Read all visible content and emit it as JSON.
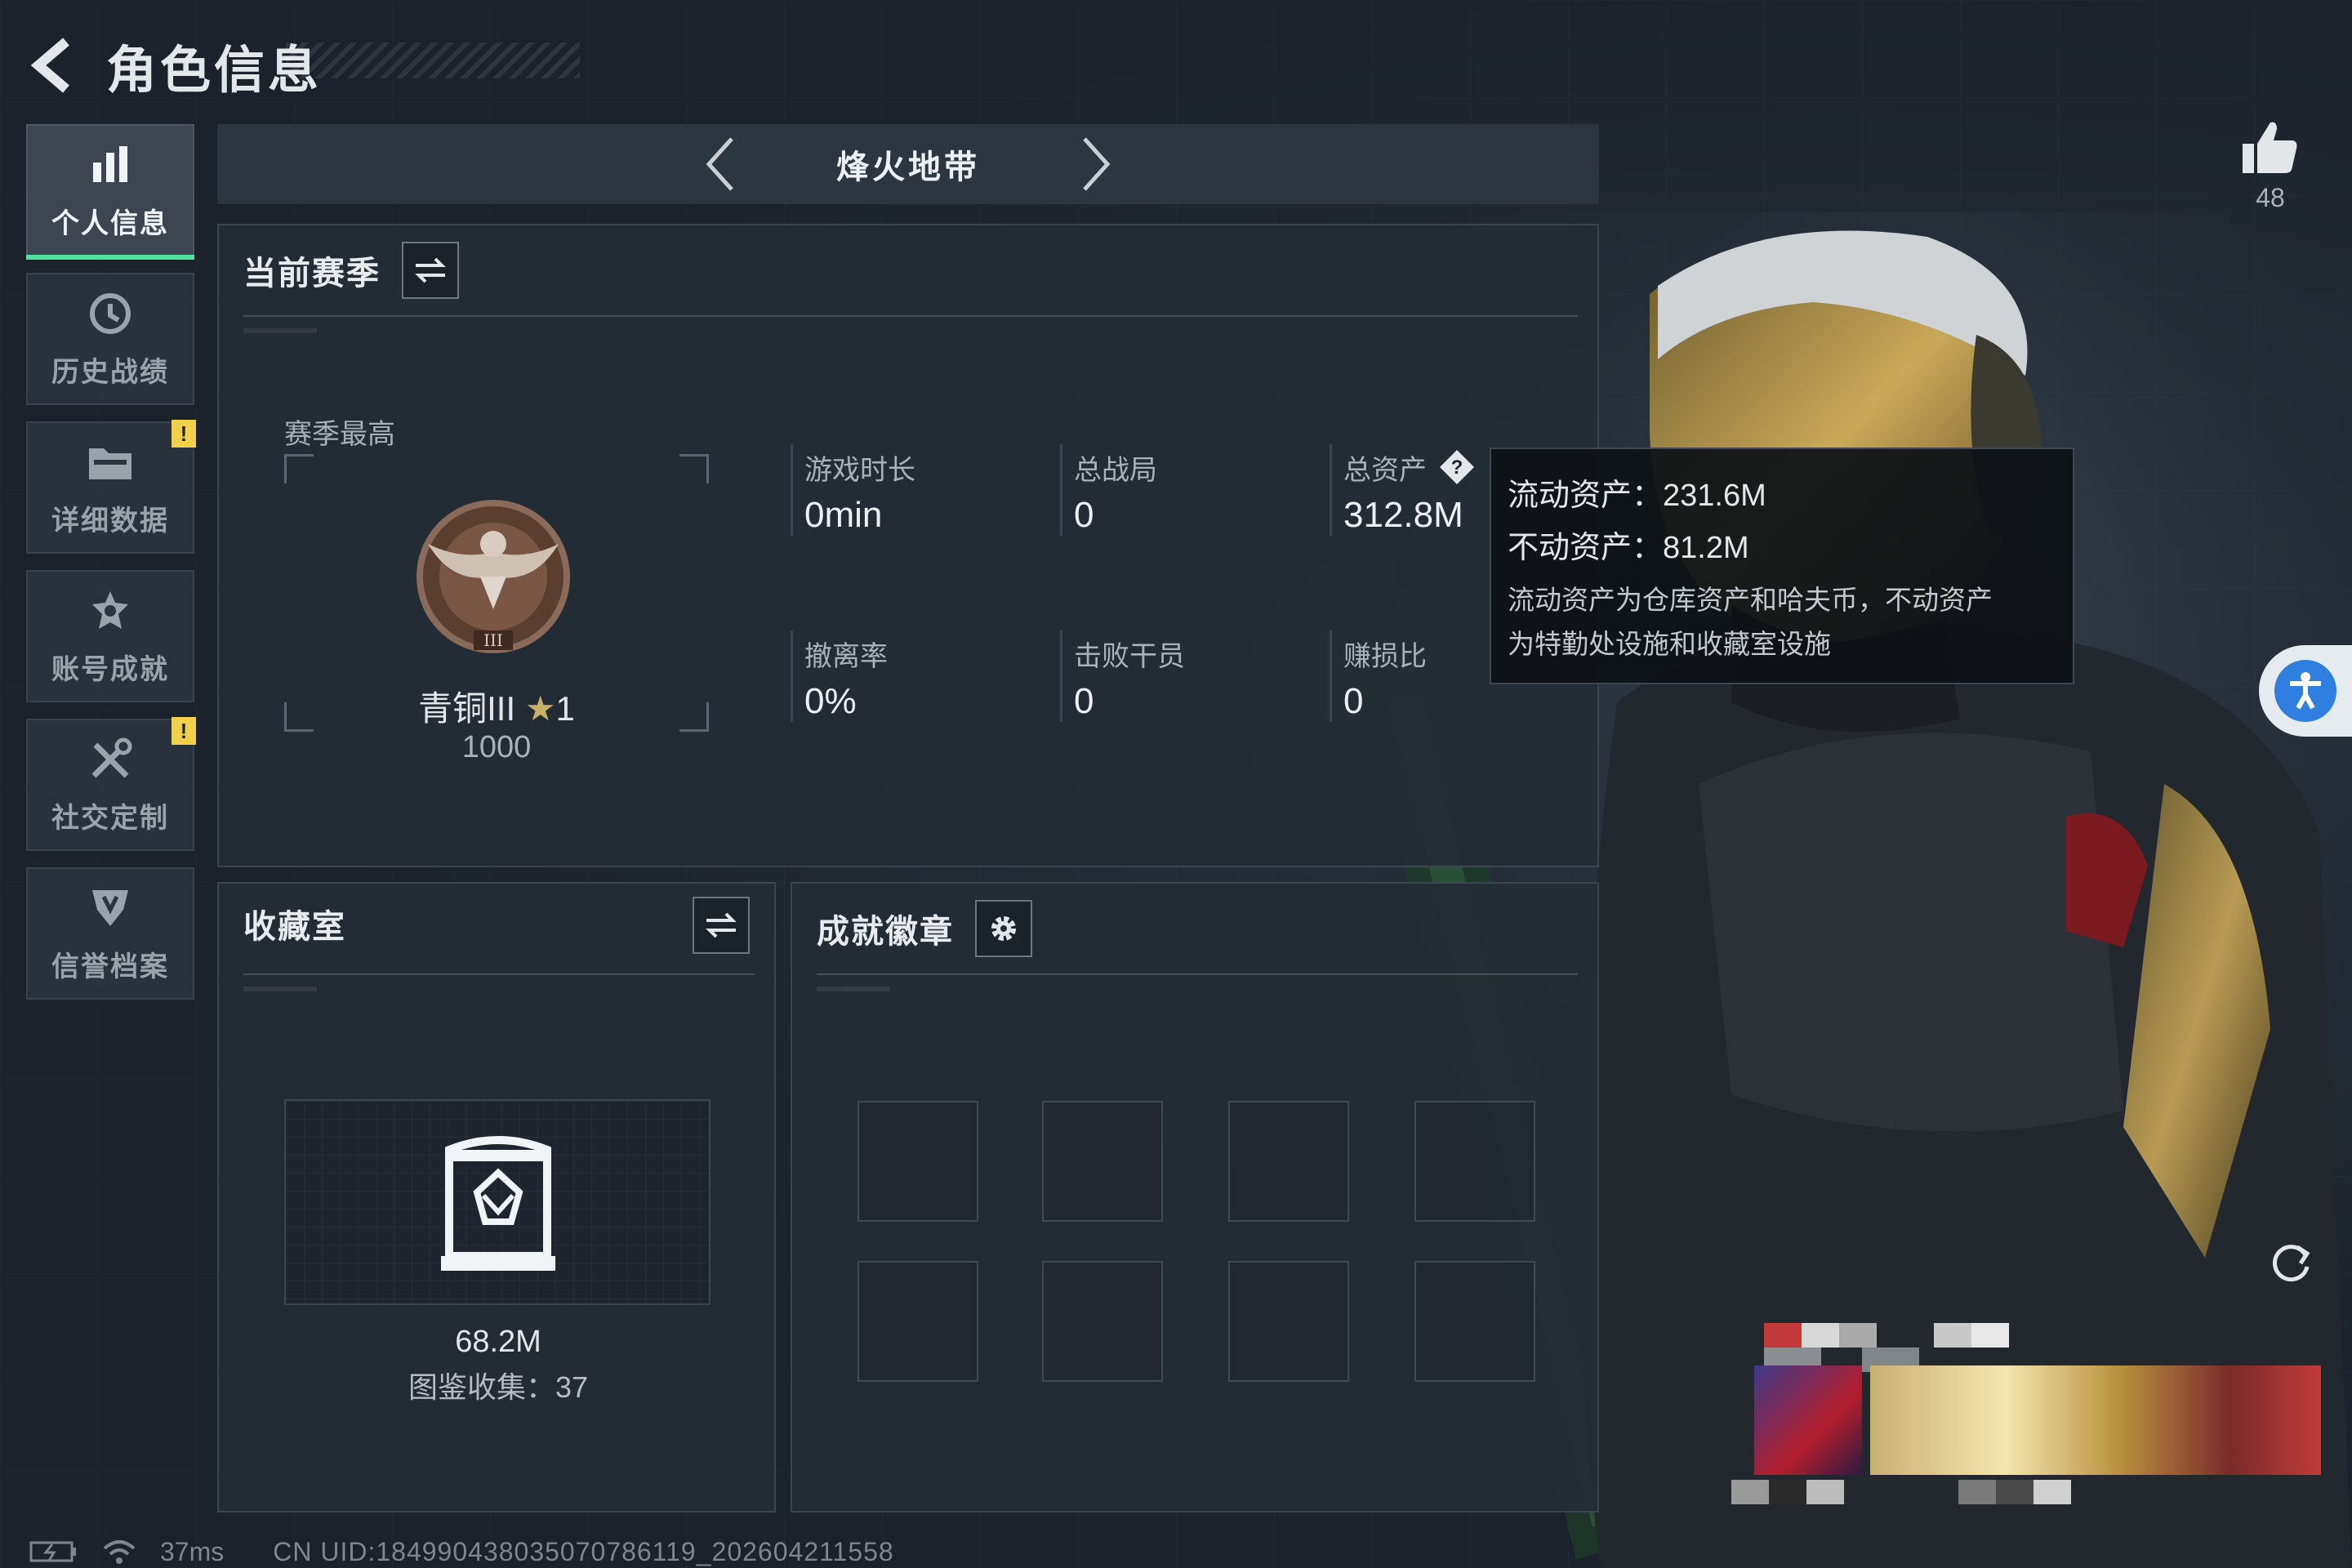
{
  "header": {
    "title": "角色信息"
  },
  "sidebar": {
    "items": [
      {
        "label": "个人信息",
        "icon": "bar-chart-icon",
        "active": true
      },
      {
        "label": "历史战绩",
        "icon": "history-clock-icon"
      },
      {
        "label": "详细数据",
        "icon": "folder-icon",
        "badge": "!"
      },
      {
        "label": "账号成就",
        "icon": "achievement-icon"
      },
      {
        "label": "社交定制",
        "icon": "tools-icon",
        "badge": "!"
      },
      {
        "label": "信誉档案",
        "icon": "shield-icon"
      }
    ]
  },
  "mode_bar": {
    "title": "烽火地带"
  },
  "season": {
    "title": "当前赛季",
    "best_label": "赛季最高",
    "rank_name": "青铜III",
    "rank_star": "★",
    "rank_stars": "1",
    "rank_score": "1000",
    "stats": [
      {
        "label": "游戏时长",
        "value": "0min"
      },
      {
        "label": "总战局",
        "value": "0"
      },
      {
        "label": "总资产",
        "value": "312.8M"
      },
      {
        "label": "撤离率",
        "value": "0%"
      },
      {
        "label": "击败干员",
        "value": "0"
      },
      {
        "label": "赚损比",
        "value": "0"
      }
    ]
  },
  "tooltip": {
    "liquid": "流动资产：231.6M",
    "fixed": "不动资产：81.2M",
    "note_line1": "流动资产为仓库资产和哈夫币，不动资产",
    "note_line2": "为特勤处设施和收藏室设施"
  },
  "collection": {
    "title": "收藏室",
    "value": "68.2M",
    "count": "图鉴收集：37"
  },
  "badges": {
    "title": "成就徽章"
  },
  "likes": {
    "count": "48"
  },
  "footer": {
    "ping": "37ms",
    "uid": "CN UID:184990438035070786119_202604211558"
  },
  "colors": {
    "accent": "#4fe3a2",
    "warning": "#f2d04a",
    "a11y": "#2e7fe0"
  }
}
